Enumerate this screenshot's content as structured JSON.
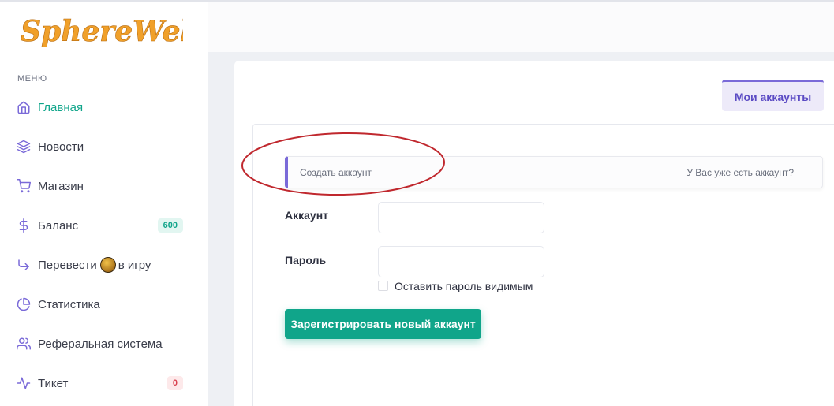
{
  "brand": {
    "logo_text": "SphereWeb",
    "logo_color": "#f0a02a"
  },
  "sidebar": {
    "menu_label": "МЕНЮ",
    "items": [
      {
        "label": "Главная",
        "icon": "home-icon",
        "active": true
      },
      {
        "label": "Новости",
        "icon": "layers-icon"
      },
      {
        "label": "Магазин",
        "icon": "cart-icon"
      },
      {
        "label": "Баланс",
        "icon": "dollar-icon",
        "badge": "600"
      },
      {
        "label": "Перевести",
        "label_suffix": "в игру",
        "icon": "arrow-down-right-icon",
        "inline_icon": "coin-icon"
      },
      {
        "label": "Статистика",
        "icon": "pie-chart-icon"
      },
      {
        "label": "Реферальная система",
        "icon": "users-icon"
      },
      {
        "label": "Тикет",
        "icon": "activity-icon",
        "badge": "0"
      }
    ]
  },
  "header": {
    "tab_label": "Мои аккаунты"
  },
  "form": {
    "switch_left": "Создать аккаунт",
    "switch_right": "У Вас уже есть аккаунт?",
    "account_label": "Аккаунт",
    "account_value": "",
    "password_label": "Пароль",
    "password_value": "",
    "show_password_label": "Оставить пароль видимым",
    "show_password_checked": false,
    "submit_label": "Зарегистрировать новый аккаунт"
  },
  "colors": {
    "accent": "#10a58a",
    "purple": "#7a6ad8",
    "annotation": "#c0282e"
  }
}
